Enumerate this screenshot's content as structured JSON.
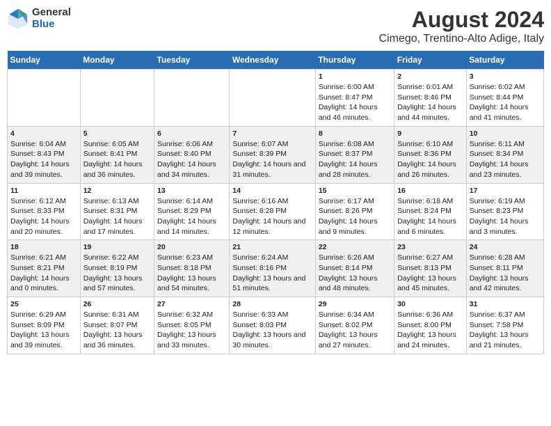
{
  "logo": {
    "general": "General",
    "blue": "Blue"
  },
  "title": "August 2024",
  "subtitle": "Cimego, Trentino-Alto Adige, Italy",
  "weekdays": [
    "Sunday",
    "Monday",
    "Tuesday",
    "Wednesday",
    "Thursday",
    "Friday",
    "Saturday"
  ],
  "weeks": [
    [
      {
        "day": "",
        "content": ""
      },
      {
        "day": "",
        "content": ""
      },
      {
        "day": "",
        "content": ""
      },
      {
        "day": "",
        "content": ""
      },
      {
        "day": "1",
        "content": "Sunrise: 6:00 AM\nSunset: 8:47 PM\nDaylight: 14 hours and 46 minutes."
      },
      {
        "day": "2",
        "content": "Sunrise: 6:01 AM\nSunset: 8:46 PM\nDaylight: 14 hours and 44 minutes."
      },
      {
        "day": "3",
        "content": "Sunrise: 6:02 AM\nSunset: 8:44 PM\nDaylight: 14 hours and 41 minutes."
      }
    ],
    [
      {
        "day": "4",
        "content": "Sunrise: 6:04 AM\nSunset: 8:43 PM\nDaylight: 14 hours and 39 minutes."
      },
      {
        "day": "5",
        "content": "Sunrise: 6:05 AM\nSunset: 8:41 PM\nDaylight: 14 hours and 36 minutes."
      },
      {
        "day": "6",
        "content": "Sunrise: 6:06 AM\nSunset: 8:40 PM\nDaylight: 14 hours and 34 minutes."
      },
      {
        "day": "7",
        "content": "Sunrise: 6:07 AM\nSunset: 8:39 PM\nDaylight: 14 hours and 31 minutes."
      },
      {
        "day": "8",
        "content": "Sunrise: 6:08 AM\nSunset: 8:37 PM\nDaylight: 14 hours and 28 minutes."
      },
      {
        "day": "9",
        "content": "Sunrise: 6:10 AM\nSunset: 8:36 PM\nDaylight: 14 hours and 26 minutes."
      },
      {
        "day": "10",
        "content": "Sunrise: 6:11 AM\nSunset: 8:34 PM\nDaylight: 14 hours and 23 minutes."
      }
    ],
    [
      {
        "day": "11",
        "content": "Sunrise: 6:12 AM\nSunset: 8:33 PM\nDaylight: 14 hours and 20 minutes."
      },
      {
        "day": "12",
        "content": "Sunrise: 6:13 AM\nSunset: 8:31 PM\nDaylight: 14 hours and 17 minutes."
      },
      {
        "day": "13",
        "content": "Sunrise: 6:14 AM\nSunset: 8:29 PM\nDaylight: 14 hours and 14 minutes."
      },
      {
        "day": "14",
        "content": "Sunrise: 6:16 AM\nSunset: 8:28 PM\nDaylight: 14 hours and 12 minutes."
      },
      {
        "day": "15",
        "content": "Sunrise: 6:17 AM\nSunset: 8:26 PM\nDaylight: 14 hours and 9 minutes."
      },
      {
        "day": "16",
        "content": "Sunrise: 6:18 AM\nSunset: 8:24 PM\nDaylight: 14 hours and 6 minutes."
      },
      {
        "day": "17",
        "content": "Sunrise: 6:19 AM\nSunset: 8:23 PM\nDaylight: 14 hours and 3 minutes."
      }
    ],
    [
      {
        "day": "18",
        "content": "Sunrise: 6:21 AM\nSunset: 8:21 PM\nDaylight: 14 hours and 0 minutes."
      },
      {
        "day": "19",
        "content": "Sunrise: 6:22 AM\nSunset: 8:19 PM\nDaylight: 13 hours and 57 minutes."
      },
      {
        "day": "20",
        "content": "Sunrise: 6:23 AM\nSunset: 8:18 PM\nDaylight: 13 hours and 54 minutes."
      },
      {
        "day": "21",
        "content": "Sunrise: 6:24 AM\nSunset: 8:16 PM\nDaylight: 13 hours and 51 minutes."
      },
      {
        "day": "22",
        "content": "Sunrise: 6:26 AM\nSunset: 8:14 PM\nDaylight: 13 hours and 48 minutes."
      },
      {
        "day": "23",
        "content": "Sunrise: 6:27 AM\nSunset: 8:13 PM\nDaylight: 13 hours and 45 minutes."
      },
      {
        "day": "24",
        "content": "Sunrise: 6:28 AM\nSunset: 8:11 PM\nDaylight: 13 hours and 42 minutes."
      }
    ],
    [
      {
        "day": "25",
        "content": "Sunrise: 6:29 AM\nSunset: 8:09 PM\nDaylight: 13 hours and 39 minutes."
      },
      {
        "day": "26",
        "content": "Sunrise: 6:31 AM\nSunset: 8:07 PM\nDaylight: 13 hours and 36 minutes."
      },
      {
        "day": "27",
        "content": "Sunrise: 6:32 AM\nSunset: 8:05 PM\nDaylight: 13 hours and 33 minutes."
      },
      {
        "day": "28",
        "content": "Sunrise: 6:33 AM\nSunset: 8:03 PM\nDaylight: 13 hours and 30 minutes."
      },
      {
        "day": "29",
        "content": "Sunrise: 6:34 AM\nSunset: 8:02 PM\nDaylight: 13 hours and 27 minutes."
      },
      {
        "day": "30",
        "content": "Sunrise: 6:36 AM\nSunset: 8:00 PM\nDaylight: 13 hours and 24 minutes."
      },
      {
        "day": "31",
        "content": "Sunrise: 6:37 AM\nSunset: 7:58 PM\nDaylight: 13 hours and 21 minutes."
      }
    ]
  ]
}
